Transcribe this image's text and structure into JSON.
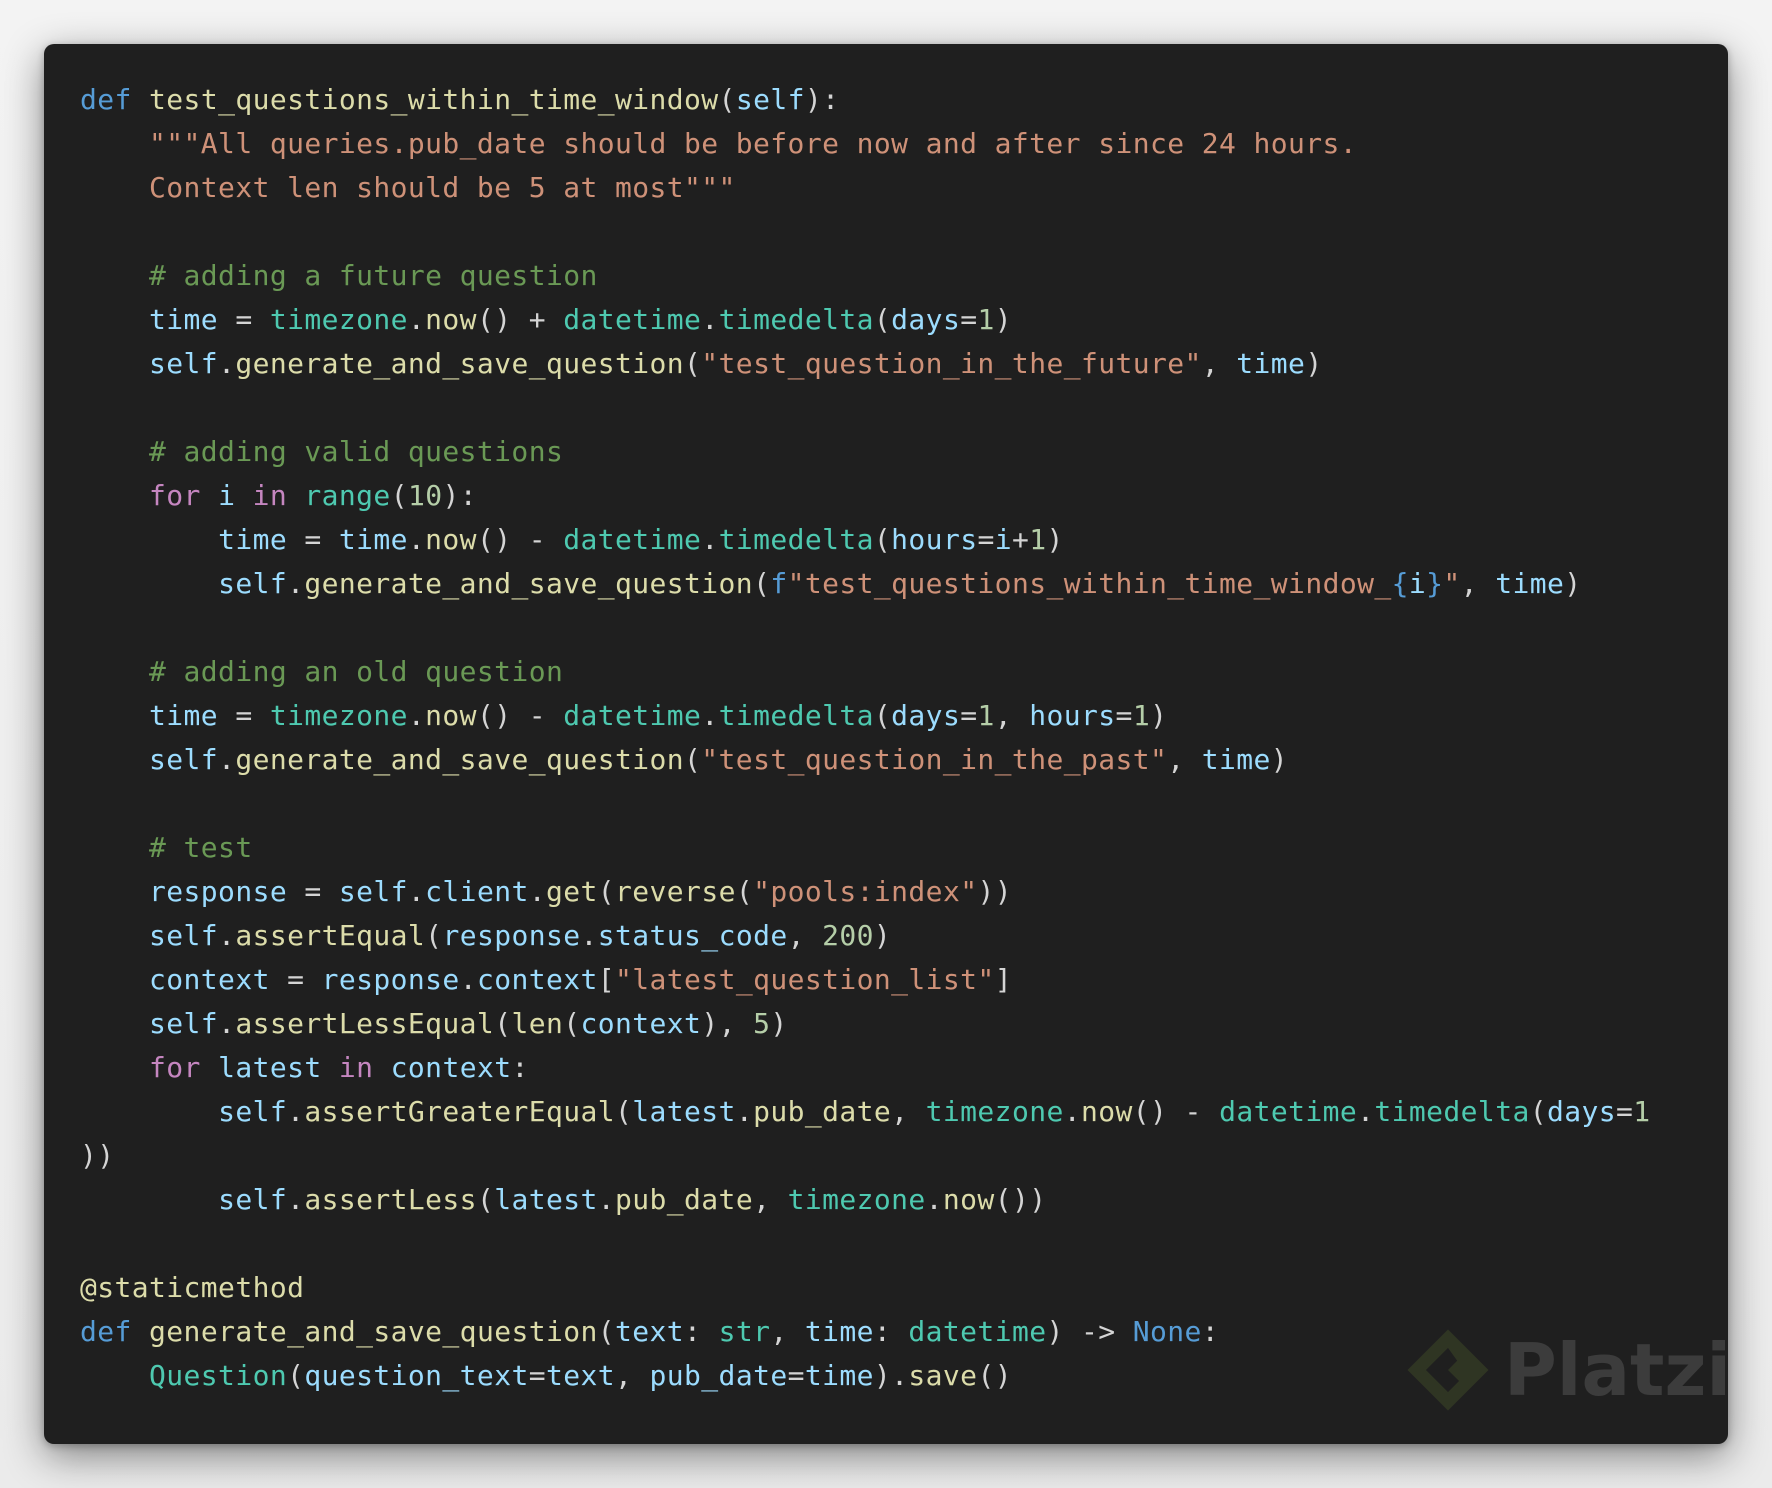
{
  "editor": {
    "language": "python",
    "theme_colors": {
      "background": "#1f1f1f",
      "keyword": "#569cd6",
      "control": "#c586c0",
      "function": "#dcdcaa",
      "string": "#ce9178",
      "comment": "#6a9955",
      "variable": "#9cdcfe",
      "class": "#4ec9b0",
      "number": "#b5cea8",
      "plain": "#d4d4d4"
    },
    "lines": [
      [
        [
          "kw",
          "def"
        ],
        [
          "plain",
          " "
        ],
        [
          "fn",
          "test_questions_within_time_window"
        ],
        [
          "plain",
          "("
        ],
        [
          "var",
          "self"
        ],
        [
          "plain",
          "):"
        ]
      ],
      [
        [
          "plain",
          "    "
        ],
        [
          "str",
          "\"\"\"All queries.pub_date should be before now and after since 24 hours."
        ]
      ],
      [
        [
          "plain",
          "    "
        ],
        [
          "str",
          "Context len should be 5 at most\"\"\""
        ]
      ],
      [],
      [
        [
          "plain",
          "    "
        ],
        [
          "cmt",
          "# adding a future question"
        ]
      ],
      [
        [
          "plain",
          "    "
        ],
        [
          "var",
          "time"
        ],
        [
          "plain",
          " = "
        ],
        [
          "cls",
          "timezone"
        ],
        [
          "plain",
          "."
        ],
        [
          "fn",
          "now"
        ],
        [
          "plain",
          "() + "
        ],
        [
          "cls",
          "datetime"
        ],
        [
          "plain",
          "."
        ],
        [
          "cls",
          "timedelta"
        ],
        [
          "plain",
          "("
        ],
        [
          "var",
          "days"
        ],
        [
          "plain",
          "="
        ],
        [
          "num",
          "1"
        ],
        [
          "plain",
          ")"
        ]
      ],
      [
        [
          "plain",
          "    "
        ],
        [
          "var",
          "self"
        ],
        [
          "plain",
          "."
        ],
        [
          "fn",
          "generate_and_save_question"
        ],
        [
          "plain",
          "("
        ],
        [
          "str",
          "\"test_question_in_the_future\""
        ],
        [
          "plain",
          ", "
        ],
        [
          "var",
          "time"
        ],
        [
          "plain",
          ")"
        ]
      ],
      [],
      [
        [
          "plain",
          "    "
        ],
        [
          "cmt",
          "# adding valid questions"
        ]
      ],
      [
        [
          "plain",
          "    "
        ],
        [
          "ctrl",
          "for"
        ],
        [
          "plain",
          " "
        ],
        [
          "var",
          "i"
        ],
        [
          "plain",
          " "
        ],
        [
          "ctrl",
          "in"
        ],
        [
          "plain",
          " "
        ],
        [
          "cls",
          "range"
        ],
        [
          "plain",
          "("
        ],
        [
          "num",
          "10"
        ],
        [
          "plain",
          "):"
        ]
      ],
      [
        [
          "plain",
          "        "
        ],
        [
          "var",
          "time"
        ],
        [
          "plain",
          " = "
        ],
        [
          "var",
          "time"
        ],
        [
          "plain",
          "."
        ],
        [
          "fn",
          "now"
        ],
        [
          "plain",
          "() - "
        ],
        [
          "cls",
          "datetime"
        ],
        [
          "plain",
          "."
        ],
        [
          "cls",
          "timedelta"
        ],
        [
          "plain",
          "("
        ],
        [
          "var",
          "hours"
        ],
        [
          "plain",
          "="
        ],
        [
          "var",
          "i"
        ],
        [
          "plain",
          "+"
        ],
        [
          "num",
          "1"
        ],
        [
          "plain",
          ")"
        ]
      ],
      [
        [
          "plain",
          "        "
        ],
        [
          "var",
          "self"
        ],
        [
          "plain",
          "."
        ],
        [
          "fn",
          "generate_and_save_question"
        ],
        [
          "plain",
          "("
        ],
        [
          "kw",
          "f"
        ],
        [
          "str",
          "\"test_questions_within_time_window_"
        ],
        [
          "kw",
          "{"
        ],
        [
          "var",
          "i"
        ],
        [
          "kw",
          "}"
        ],
        [
          "str",
          "\""
        ],
        [
          "plain",
          ", "
        ],
        [
          "var",
          "time"
        ],
        [
          "plain",
          ")"
        ]
      ],
      [],
      [
        [
          "plain",
          "    "
        ],
        [
          "cmt",
          "# adding an old question"
        ]
      ],
      [
        [
          "plain",
          "    "
        ],
        [
          "var",
          "time"
        ],
        [
          "plain",
          " = "
        ],
        [
          "cls",
          "timezone"
        ],
        [
          "plain",
          "."
        ],
        [
          "fn",
          "now"
        ],
        [
          "plain",
          "() - "
        ],
        [
          "cls",
          "datetime"
        ],
        [
          "plain",
          "."
        ],
        [
          "cls",
          "timedelta"
        ],
        [
          "plain",
          "("
        ],
        [
          "var",
          "days"
        ],
        [
          "plain",
          "="
        ],
        [
          "num",
          "1"
        ],
        [
          "plain",
          ", "
        ],
        [
          "var",
          "hours"
        ],
        [
          "plain",
          "="
        ],
        [
          "num",
          "1"
        ],
        [
          "plain",
          ")"
        ]
      ],
      [
        [
          "plain",
          "    "
        ],
        [
          "var",
          "self"
        ],
        [
          "plain",
          "."
        ],
        [
          "fn",
          "generate_and_save_question"
        ],
        [
          "plain",
          "("
        ],
        [
          "str",
          "\"test_question_in_the_past\""
        ],
        [
          "plain",
          ", "
        ],
        [
          "var",
          "time"
        ],
        [
          "plain",
          ")"
        ]
      ],
      [],
      [
        [
          "plain",
          "    "
        ],
        [
          "cmt",
          "# test"
        ]
      ],
      [
        [
          "plain",
          "    "
        ],
        [
          "var",
          "response"
        ],
        [
          "plain",
          " = "
        ],
        [
          "var",
          "self"
        ],
        [
          "plain",
          "."
        ],
        [
          "var",
          "client"
        ],
        [
          "plain",
          "."
        ],
        [
          "fn",
          "get"
        ],
        [
          "plain",
          "("
        ],
        [
          "fn",
          "reverse"
        ],
        [
          "plain",
          "("
        ],
        [
          "str",
          "\"pools:index\""
        ],
        [
          "plain",
          "))"
        ]
      ],
      [
        [
          "plain",
          "    "
        ],
        [
          "var",
          "self"
        ],
        [
          "plain",
          "."
        ],
        [
          "fn",
          "assertEqual"
        ],
        [
          "plain",
          "("
        ],
        [
          "var",
          "response"
        ],
        [
          "plain",
          "."
        ],
        [
          "var",
          "status_code"
        ],
        [
          "plain",
          ", "
        ],
        [
          "num",
          "200"
        ],
        [
          "plain",
          ")"
        ]
      ],
      [
        [
          "plain",
          "    "
        ],
        [
          "var",
          "context"
        ],
        [
          "plain",
          " = "
        ],
        [
          "var",
          "response"
        ],
        [
          "plain",
          "."
        ],
        [
          "var",
          "context"
        ],
        [
          "plain",
          "["
        ],
        [
          "str",
          "\"latest_question_list\""
        ],
        [
          "plain",
          "]"
        ]
      ],
      [
        [
          "plain",
          "    "
        ],
        [
          "var",
          "self"
        ],
        [
          "plain",
          "."
        ],
        [
          "fn",
          "assertLessEqual"
        ],
        [
          "plain",
          "("
        ],
        [
          "fn",
          "len"
        ],
        [
          "plain",
          "("
        ],
        [
          "var",
          "context"
        ],
        [
          "plain",
          "), "
        ],
        [
          "num",
          "5"
        ],
        [
          "plain",
          ")"
        ]
      ],
      [
        [
          "plain",
          "    "
        ],
        [
          "ctrl",
          "for"
        ],
        [
          "plain",
          " "
        ],
        [
          "var",
          "latest"
        ],
        [
          "plain",
          " "
        ],
        [
          "ctrl",
          "in"
        ],
        [
          "plain",
          " "
        ],
        [
          "var",
          "context"
        ],
        [
          "plain",
          ":"
        ]
      ],
      [
        [
          "plain",
          "        "
        ],
        [
          "var",
          "self"
        ],
        [
          "plain",
          "."
        ],
        [
          "fn",
          "assertGreaterEqual"
        ],
        [
          "plain",
          "("
        ],
        [
          "var",
          "latest"
        ],
        [
          "plain",
          "."
        ],
        [
          "fn",
          "pub_date"
        ],
        [
          "plain",
          ", "
        ],
        [
          "cls",
          "timezone"
        ],
        [
          "plain",
          "."
        ],
        [
          "fn",
          "now"
        ],
        [
          "plain",
          "() - "
        ],
        [
          "cls",
          "datetime"
        ],
        [
          "plain",
          "."
        ],
        [
          "cls",
          "timedelta"
        ],
        [
          "plain",
          "("
        ],
        [
          "var",
          "days"
        ],
        [
          "plain",
          "="
        ],
        [
          "num",
          "1"
        ]
      ],
      [
        [
          "plain",
          "))"
        ]
      ],
      [
        [
          "plain",
          "        "
        ],
        [
          "var",
          "self"
        ],
        [
          "plain",
          "."
        ],
        [
          "fn",
          "assertLess"
        ],
        [
          "plain",
          "("
        ],
        [
          "var",
          "latest"
        ],
        [
          "plain",
          "."
        ],
        [
          "fn",
          "pub_date"
        ],
        [
          "plain",
          ", "
        ],
        [
          "cls",
          "timezone"
        ],
        [
          "plain",
          "."
        ],
        [
          "fn",
          "now"
        ],
        [
          "plain",
          "())"
        ]
      ],
      [],
      [
        [
          "dec",
          "@staticmethod"
        ]
      ],
      [
        [
          "kw",
          "def"
        ],
        [
          "plain",
          " "
        ],
        [
          "fn",
          "generate_and_save_question"
        ],
        [
          "plain",
          "("
        ],
        [
          "var",
          "text"
        ],
        [
          "plain",
          ": "
        ],
        [
          "cls",
          "str"
        ],
        [
          "plain",
          ", "
        ],
        [
          "var",
          "time"
        ],
        [
          "plain",
          ": "
        ],
        [
          "cls",
          "datetime"
        ],
        [
          "plain",
          ") -> "
        ],
        [
          "kw",
          "None"
        ],
        [
          "plain",
          ":"
        ]
      ],
      [
        [
          "plain",
          "    "
        ],
        [
          "cls",
          "Question"
        ],
        [
          "plain",
          "("
        ],
        [
          "var",
          "question_text"
        ],
        [
          "plain",
          "="
        ],
        [
          "var",
          "text"
        ],
        [
          "plain",
          ", "
        ],
        [
          "var",
          "pub_date"
        ],
        [
          "plain",
          "="
        ],
        [
          "var",
          "time"
        ],
        [
          "plain",
          ")."
        ],
        [
          "fn",
          "save"
        ],
        [
          "plain",
          "()"
        ]
      ]
    ]
  },
  "watermark": {
    "text": "Platzi",
    "icon": "platzi-logo-icon"
  }
}
